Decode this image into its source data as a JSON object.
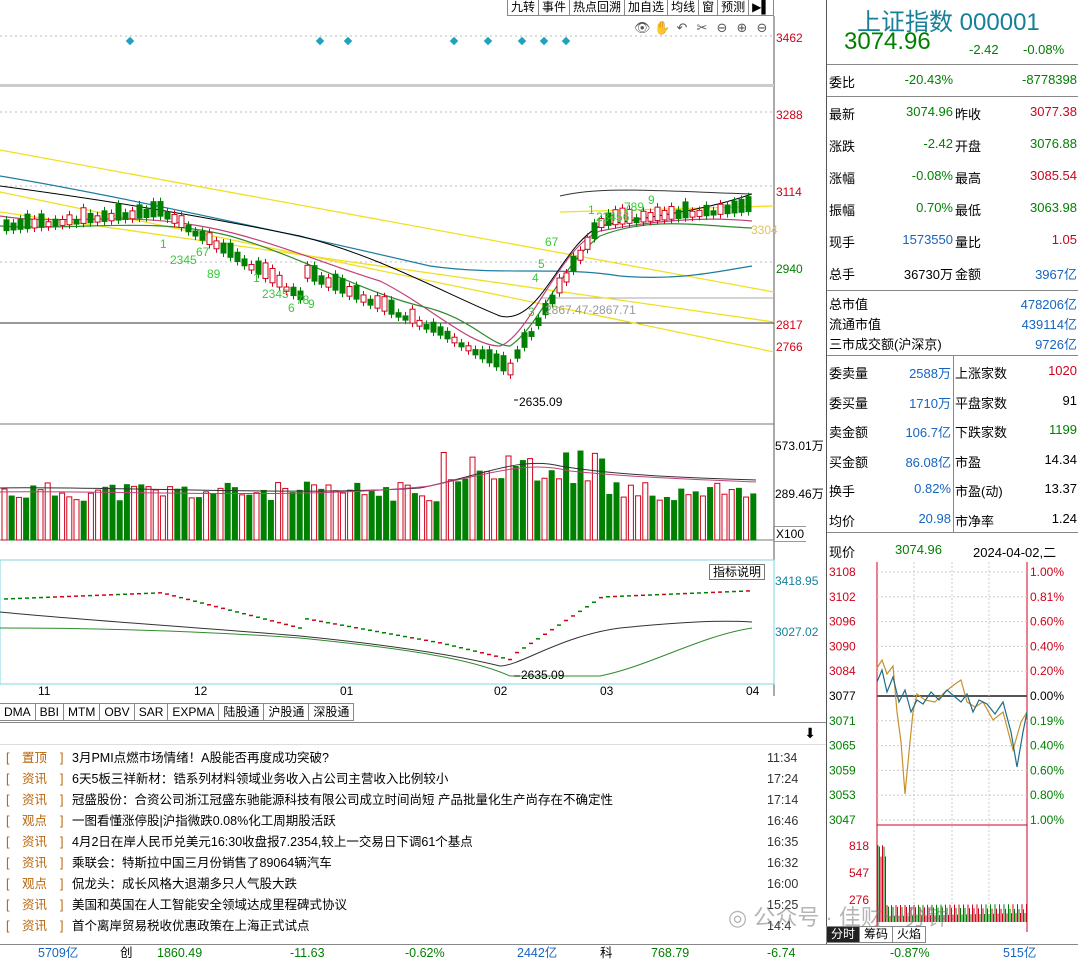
{
  "toolbar": {
    "buttons": [
      "九转",
      "事件",
      "热点回溯",
      "加自选",
      "均线",
      "窗",
      "预测"
    ],
    "exit_glyph": "▶▌"
  },
  "chart_tools": [
    "👁",
    "✋",
    "↶",
    "✂",
    "⊖",
    "⊕",
    "⊖"
  ],
  "main_chart": {
    "price_axis": [
      "3462",
      "3288",
      "3114",
      "2940",
      "2817",
      "2766"
    ],
    "high_mark_label": "3304",
    "low_label": "2635.09",
    "range_label": "2867.47-2867.71",
    "volume_axis": [
      "573.01万",
      "289.46万"
    ],
    "volume_unit": "X100",
    "macd_axis": [
      "3418.95",
      "3027.02"
    ],
    "macd_low_label": "2635.09",
    "indicator_button": "指标说明",
    "date_ticks": [
      "11",
      "12",
      "01",
      "02",
      "03",
      "04"
    ],
    "seq_labels": [
      "1",
      "2",
      "3",
      "4",
      "5",
      "6",
      "7",
      "8",
      "9"
    ]
  },
  "indicator_tabs": [
    "DMA",
    "BBI",
    "MTM",
    "OBV",
    "SAR",
    "EXPMA",
    "陆股通",
    "沪股通",
    "深股通"
  ],
  "news": {
    "items": [
      {
        "tag": "置顶",
        "title": "3月PMI点燃市场情绪！A股能否再度成功突破?",
        "time": "11:34"
      },
      {
        "tag": "资讯",
        "title": "6天5板三祥新材：锆系列材料领域业务收入占公司主营收入比例较小",
        "time": "17:24"
      },
      {
        "tag": "资讯",
        "title": "冠盛股份：合资公司浙江冠盛东驰能源科技有限公司成立时间尚短 产品批量化生产尚存在不确定性",
        "time": "17:14"
      },
      {
        "tag": "观点",
        "title": "一图看懂涨停股|沪指微跌0.08%化工周期股活跃",
        "time": "16:46"
      },
      {
        "tag": "资讯",
        "title": "4月2日在岸人民币兑美元16:30收盘报7.2354,较上一交易日下调61个基点",
        "time": "16:35"
      },
      {
        "tag": "资讯",
        "title": "乘联会：特斯拉中国三月份销售了89064辆汽车",
        "time": "16:32"
      },
      {
        "tag": "观点",
        "title": "侃龙头：成长风格大退潮多只人气股大跌",
        "time": "16:00"
      },
      {
        "tag": "资讯",
        "title": "美国和英国在人工智能安全领域达成里程碑式协议",
        "time": "15:25"
      },
      {
        "tag": "资讯",
        "title": "首个离岸贸易税收优惠政策在上海正式试点",
        "time": "14:4"
      }
    ]
  },
  "bottom_bar": {
    "v1": "5709亿",
    "mkt2": "创",
    "v2": "1860.49",
    "v3": "-11.63",
    "v4": "-0.62%",
    "v5": "2442亿",
    "mkt3": "科",
    "v6": "768.79",
    "v7": "-6.74",
    "v8": "-0.87%",
    "v9": "515亿"
  },
  "quote": {
    "name": "上证指数",
    "code": "000001",
    "price": "3074.96",
    "change": "-2.42",
    "pct": "-0.08%",
    "weibi_label": "委比",
    "weibi_pct": "-20.43%",
    "weibi_val": "-8778398",
    "rows": [
      {
        "l1": "最新",
        "v1": "3074.96",
        "l2": "昨收",
        "v2": "3077.38"
      },
      {
        "l1": "涨跌",
        "v1": "-2.42",
        "l2": "开盘",
        "v2": "3076.88"
      },
      {
        "l1": "涨幅",
        "v1": "-0.08%",
        "l2": "最高",
        "v2": "3085.54"
      },
      {
        "l1": "振幅",
        "v1": "0.70%",
        "l2": "最低",
        "v2": "3063.98"
      },
      {
        "l1": "现手",
        "v1": "1573550",
        "l2": "量比",
        "v2": "1.05"
      },
      {
        "l1": "总手",
        "v1": "36730万",
        "l2": "金额",
        "v2": "3967亿"
      }
    ],
    "mkt_rows": [
      {
        "l": "总市值",
        "v": "478206亿"
      },
      {
        "l": "流通市值",
        "v": "439114亿"
      },
      {
        "l": "三市成交额(沪深京)",
        "v": "9726亿"
      }
    ],
    "order_rows": [
      {
        "l1": "委卖量",
        "v1": "2588万",
        "l2": "上涨家数",
        "v2": "1020"
      },
      {
        "l1": "委买量",
        "v1": "1710万",
        "l2": "平盘家数",
        "v2": "91"
      },
      {
        "l1": "卖金额",
        "v1": "106.7亿",
        "l2": "下跌家数",
        "v2": "1199"
      },
      {
        "l1": "买金额",
        "v1": "86.08亿",
        "l2": "市盈",
        "v2": "14.34"
      },
      {
        "l1": "换手",
        "v1": "0.82%",
        "l2": "市盈(动)",
        "v2": "13.37"
      },
      {
        "l1": "均价",
        "v1": "20.98",
        "l2": "市净率",
        "v2": "1.24"
      }
    ]
  },
  "intraday": {
    "label": "现价",
    "price": "3074.96",
    "date": "2024-04-02,二",
    "price_axis": [
      "3108",
      "3102",
      "3096",
      "3090",
      "3084",
      "3077",
      "3071",
      "3065",
      "3059",
      "3053",
      "3047"
    ],
    "pct_axis": [
      "1.00%",
      "0.81%",
      "0.60%",
      "0.40%",
      "0.20%",
      "0.00%",
      "0.19%",
      "0.40%",
      "0.60%",
      "0.80%",
      "1.00%"
    ],
    "vol_axis": [
      "818",
      "547",
      "276"
    ],
    "tabs": [
      "分时",
      "筹码",
      "火焰"
    ]
  },
  "watermark": "公众号 · 佳财一分钟"
}
